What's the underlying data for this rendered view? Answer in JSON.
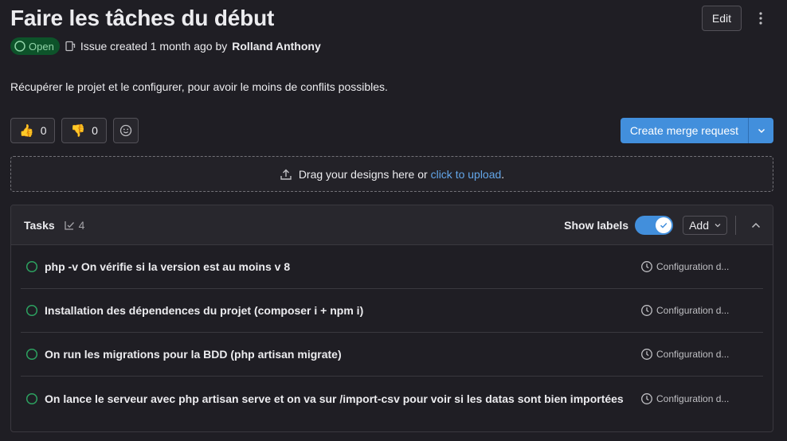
{
  "issue": {
    "title": "Faire les tâches du début",
    "edit_label": "Edit",
    "status": "Open",
    "meta_prefix": "Issue created 1 month ago by",
    "author": "Rolland Anthony",
    "description": "Récupérer le projet et le configurer, pour avoir le moins de conflits possibles."
  },
  "reactions": {
    "thumbs_up_count": "0",
    "thumbs_down_count": "0",
    "thumbs_up_icon": "👍",
    "thumbs_down_icon": "👎"
  },
  "merge_request": {
    "label": "Create merge request"
  },
  "dropzone": {
    "text": "Drag your designs here or",
    "link": "click to upload",
    "suffix": "."
  },
  "tasks": {
    "title": "Tasks",
    "count": "4",
    "show_labels": "Show labels",
    "add_label": "Add",
    "items": [
      {
        "title": "php -v On vérifie si la version est au moins v 8",
        "milestone": "Configuration d..."
      },
      {
        "title": "Installation des dépendences du projet (composer i + npm i)",
        "milestone": "Configuration d..."
      },
      {
        "title": "On run les migrations pour la BDD (php artisan migrate)",
        "milestone": "Configuration d..."
      },
      {
        "title": "On lance le serveur avec php artisan serve et on va sur /import-csv pour voir si les datas sont bien importées",
        "milestone": "Configuration d..."
      }
    ]
  },
  "colors": {
    "background": "#1f1e24",
    "accent": "#428fdc",
    "open_badge_bg": "#0d532a",
    "open_badge_text": "#91d4a8",
    "task_open": "#2da160",
    "link": "#63a6e9"
  }
}
